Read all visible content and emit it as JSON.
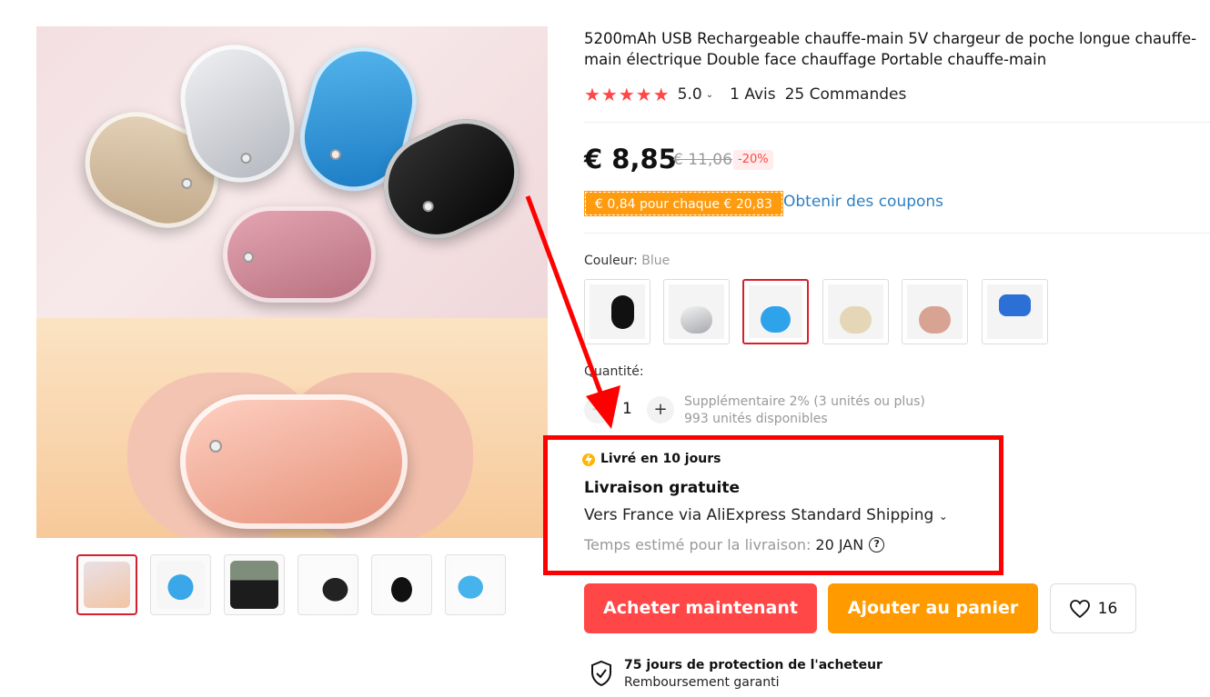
{
  "product": {
    "title": "5200mAh USB Rechargeable chauffe-main 5V chargeur de poche longue chauffe-main électrique Double face chauffage Portable chauffe-main",
    "stars": "★★★★★",
    "rating": "5.0",
    "reviews": "1 Avis",
    "orders": "25 Commandes"
  },
  "pricing": {
    "price": "€ 8,85",
    "old_price": "€ 11,06",
    "discount": "-20%",
    "coupon_tag": "€ 0,84 pour chaque € 20,83",
    "coupon_link": "Obtenir des coupons"
  },
  "color": {
    "label": "Couleur:",
    "selected": "Blue",
    "options": [
      "black",
      "silver",
      "blue",
      "gold",
      "pink",
      "blue-pack"
    ]
  },
  "quantity": {
    "label": "Quantité:",
    "minus": "−",
    "value": "1",
    "plus": "+",
    "extra_line1": "Supplémentaire 2% (3 unités ou plus)",
    "extra_line2": "993 unités disponibles"
  },
  "shipping": {
    "badge": "Livré en 10 jours",
    "free": "Livraison gratuite",
    "via": "Vers France via AliExpress Standard Shipping",
    "chevron": "⌄",
    "est_label": "Temps estimé pour la livraison:",
    "est_date": "20 JAN",
    "help": "?"
  },
  "actions": {
    "buy_now": "Acheter maintenant",
    "add_to_cart": "Ajouter au panier",
    "wishlist_count": "16"
  },
  "protection": {
    "title": "75 jours de protection de l'acheteur",
    "subtitle": "Remboursement garanti"
  },
  "colors": {
    "accent_red": "#ff4747",
    "accent_orange": "#ff9a00",
    "link_blue": "#2e7fc2",
    "annotation_red": "#ff0000"
  }
}
